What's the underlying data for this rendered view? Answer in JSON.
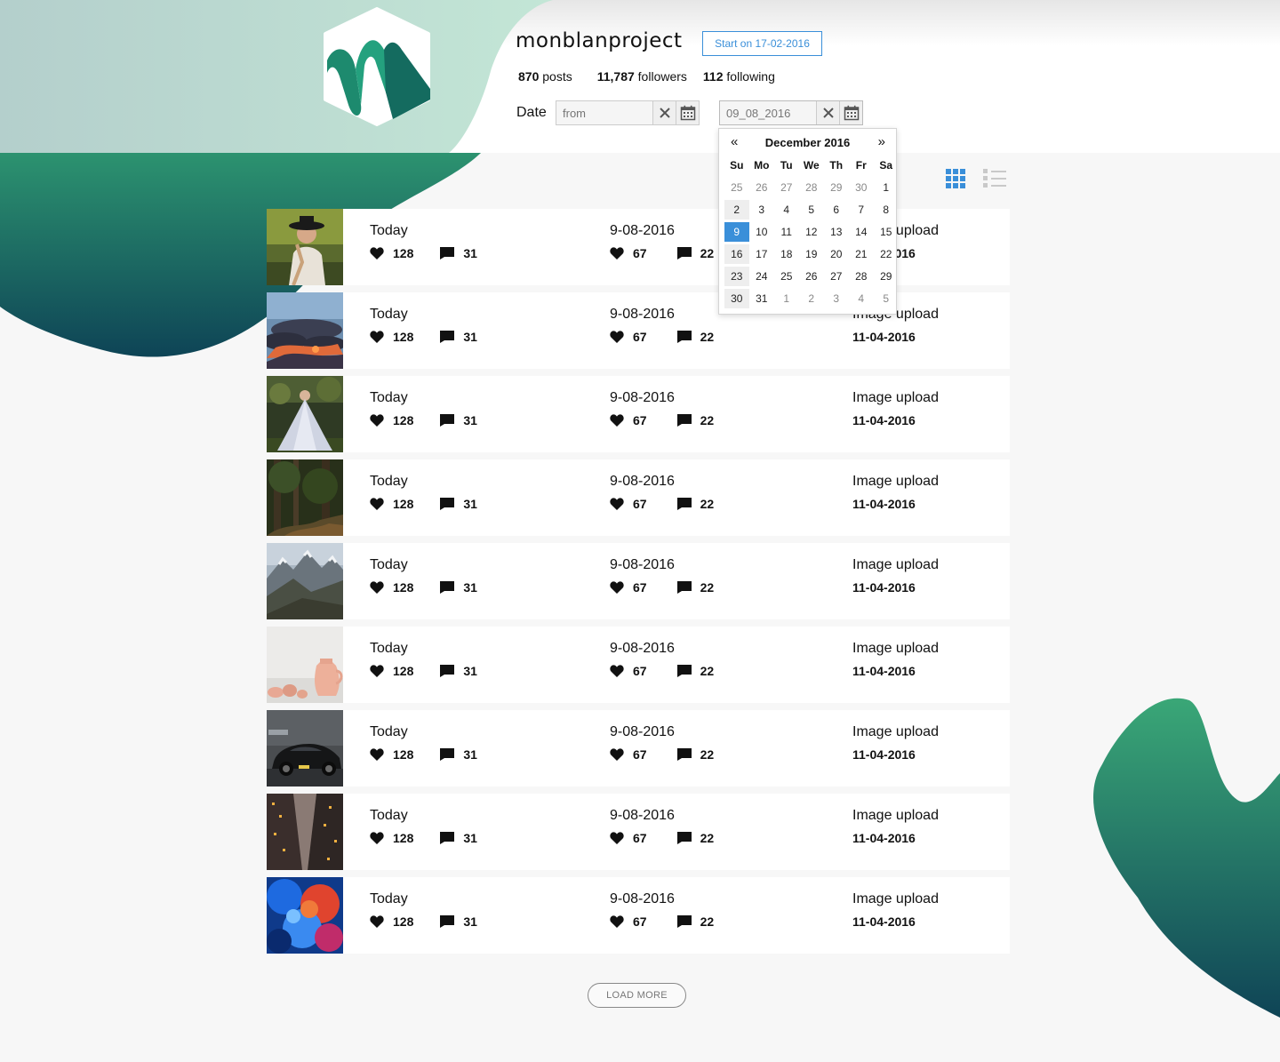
{
  "profile": {
    "name": "monblanproject",
    "start_badge": "Start on  17-02-2016",
    "stats": [
      {
        "value": "870",
        "label": "posts"
      },
      {
        "value": "11,787",
        "label": "followers"
      },
      {
        "value": "112",
        "label": "following"
      }
    ]
  },
  "filter": {
    "date_label": "Date",
    "from_placeholder": "from",
    "to_value": "09_08_2016"
  },
  "calendar": {
    "prev": "«",
    "next": "»",
    "title": "December 2016",
    "days_of_week": [
      "Su",
      "Mo",
      "Tu",
      "We",
      "Th",
      "Fr",
      "Sa"
    ],
    "weeks": [
      [
        "25",
        "26",
        "27",
        "28",
        "29",
        "30",
        "1"
      ],
      [
        "2",
        "3",
        "4",
        "5",
        "6",
        "7",
        "8"
      ],
      [
        "9",
        "10",
        "11",
        "12",
        "13",
        "14",
        "15"
      ],
      [
        "16",
        "17",
        "18",
        "19",
        "20",
        "21",
        "22"
      ],
      [
        "23",
        "24",
        "25",
        "26",
        "27",
        "28",
        "29"
      ],
      [
        "30",
        "31",
        "1",
        "2",
        "3",
        "4",
        "5"
      ]
    ],
    "selected": "9"
  },
  "posts": [
    {
      "image": "woman-hat",
      "c1_title": "Today",
      "c1_likes": "128",
      "c1_comments": "31",
      "c2_title": "9-08-2016",
      "c2_likes": "67",
      "c2_comments": "22",
      "c3_title": "Image upload",
      "c3_date": "11-04-2016"
    },
    {
      "image": "sunset-clouds",
      "c1_title": "Today",
      "c1_likes": "128",
      "c1_comments": "31",
      "c2_title": "9-08-2016",
      "c2_likes": "67",
      "c2_comments": "22",
      "c3_title": "Image upload",
      "c3_date": "11-04-2016"
    },
    {
      "image": "woman-dress",
      "c1_title": "Today",
      "c1_likes": "128",
      "c1_comments": "31",
      "c2_title": "9-08-2016",
      "c2_likes": "67",
      "c2_comments": "22",
      "c3_title": "Image upload",
      "c3_date": "11-04-2016"
    },
    {
      "image": "forest",
      "c1_title": "Today",
      "c1_likes": "128",
      "c1_comments": "31",
      "c2_title": "9-08-2016",
      "c2_likes": "67",
      "c2_comments": "22",
      "c3_title": "Image upload",
      "c3_date": "11-04-2016"
    },
    {
      "image": "mountains",
      "c1_title": "Today",
      "c1_likes": "128",
      "c1_comments": "31",
      "c2_title": "9-08-2016",
      "c2_likes": "67",
      "c2_comments": "22",
      "c3_title": "Image upload",
      "c3_date": "11-04-2016"
    },
    {
      "image": "vases",
      "c1_title": "Today",
      "c1_likes": "128",
      "c1_comments": "31",
      "c2_title": "9-08-2016",
      "c2_likes": "67",
      "c2_comments": "22",
      "c3_title": "Image upload",
      "c3_date": "11-04-2016"
    },
    {
      "image": "black-car",
      "c1_title": "Today",
      "c1_likes": "128",
      "c1_comments": "31",
      "c2_title": "9-08-2016",
      "c2_likes": "67",
      "c2_comments": "22",
      "c3_title": "Image upload",
      "c3_date": "11-04-2016"
    },
    {
      "image": "city-buildings",
      "c1_title": "Today",
      "c1_likes": "128",
      "c1_comments": "31",
      "c2_title": "9-08-2016",
      "c2_likes": "67",
      "c2_comments": "22",
      "c3_title": "Image upload",
      "c3_date": "11-04-2016"
    },
    {
      "image": "color-smoke",
      "c1_title": "Today",
      "c1_likes": "128",
      "c1_comments": "31",
      "c2_title": "9-08-2016",
      "c2_likes": "67",
      "c2_comments": "22",
      "c3_title": "Image upload",
      "c3_date": "11-04-2016"
    }
  ],
  "load_more": "LOAD MORE",
  "colors": {
    "accent": "#3a8fd9",
    "brand_green": "#1e7a62",
    "brand_dark": "#0f4a55",
    "brand_light": "#bfe0d2"
  }
}
